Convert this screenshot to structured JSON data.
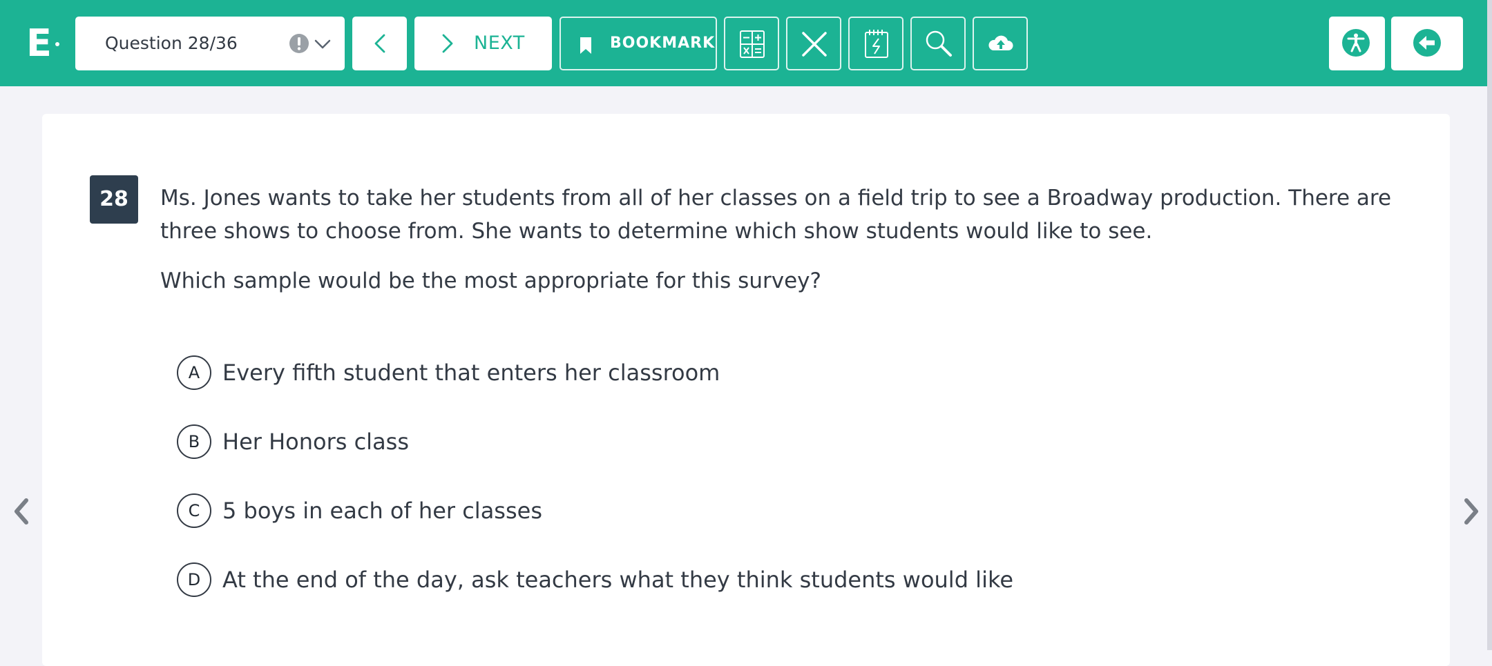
{
  "app": {
    "logo_letter": "E"
  },
  "toolbar": {
    "question_selector": "Question 28/36",
    "next_label": "NEXT",
    "bookmark_label": "BOOKMARK"
  },
  "question": {
    "number": "28",
    "stem": "Ms. Jones wants to take her students from all of her classes on a field trip to see a Broadway production.  There are three shows to choose from.  She wants to determine which show students would like to see.",
    "prompt": "Which sample would be the most appropriate for this survey?",
    "choices": [
      {
        "letter": "A",
        "text": "Every fifth student that enters her classroom"
      },
      {
        "letter": "B",
        "text": "Her Honors class"
      },
      {
        "letter": "C",
        "text": "5 boys in each of her classes"
      },
      {
        "letter": "D",
        "text": "At the end of the day, ask teachers what they think students would like"
      }
    ]
  },
  "colors": {
    "toolbar_bg": "#1cb394",
    "question_badge_bg": "#2e3e4e",
    "page_bg": "#f3f3f8",
    "text": "#333a44"
  },
  "icons": {
    "flag_alert": "exclamation-circle-icon",
    "calculator": "calculator-icon",
    "eliminate": "x-icon",
    "notepad": "notepad-icon",
    "magnifier": "magnifier-icon",
    "save": "cloud-upload-icon",
    "accessibility": "accessibility-icon",
    "exit": "arrow-left-circle-icon"
  }
}
